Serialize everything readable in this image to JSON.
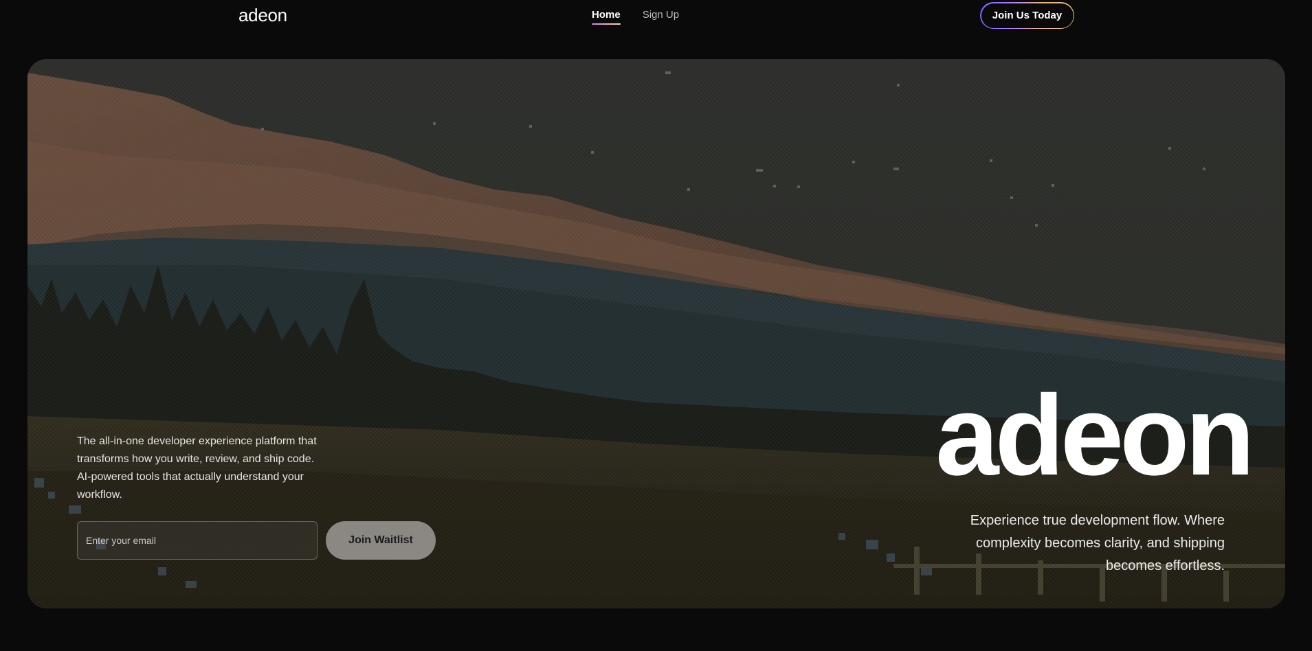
{
  "nav": {
    "logo": "adeon",
    "links": [
      {
        "label": "Home",
        "active": true
      },
      {
        "label": "Sign Up",
        "active": false
      }
    ],
    "cta_label": "Join Us Today"
  },
  "hero": {
    "tagline": "The all-in-one developer experience platform that transforms how you write, review, and ship code. AI-powered tools that actually understand your workflow.",
    "email_placeholder": "Enter your email",
    "waitlist_label": "Join Waitlist",
    "title": "adeon",
    "subtitle": "Experience true development flow. Where complexity becomes clarity, and shipping becomes effortless."
  },
  "colors": {
    "background": "#0a0a0a",
    "button_bg": "#8b8783",
    "accent_gradient": [
      "#6c6cff",
      "#b37dff",
      "#f0b37a",
      "#e8c56b"
    ]
  }
}
